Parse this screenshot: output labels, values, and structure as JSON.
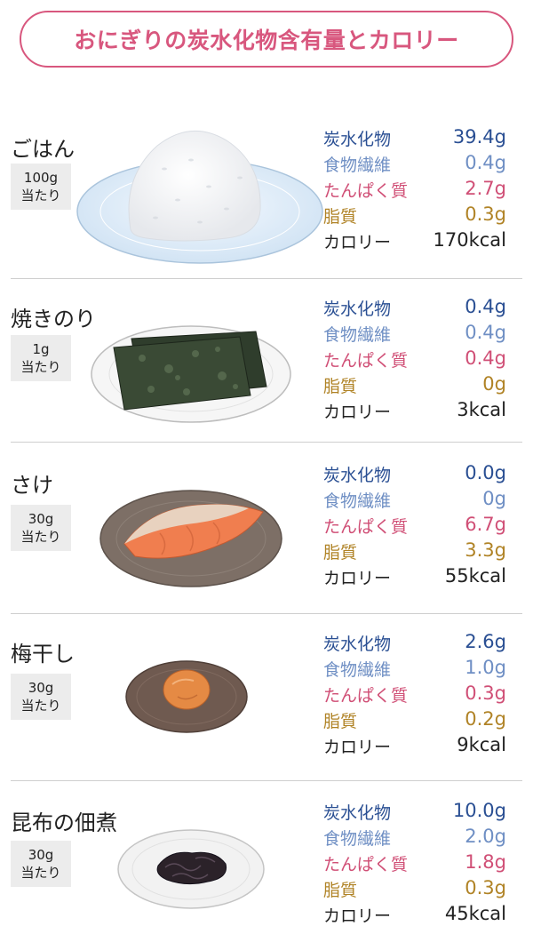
{
  "title": "おにぎりの炭水化物含有量とカロリー",
  "labels": {
    "carb": "炭水化物",
    "fiber": "食物繊維",
    "protein": "たんぱく質",
    "fat": "脂質",
    "calorie": "カロリー"
  },
  "colors": {
    "title": "#d8577e",
    "carb": "#2a4f93",
    "fiber": "#6f8fc4",
    "protein": "#d04f76",
    "fat": "#b08326",
    "calorie": "#222222"
  },
  "foods": [
    {
      "name": "ごはん",
      "amount": "100g",
      "per": "当たり",
      "carb": "39.4g",
      "fiber": "0.4g",
      "protein": "2.7g",
      "fat": "0.3g",
      "calorie": "170kcal",
      "icon": "onigiri-rice-icon"
    },
    {
      "name": "焼きのり",
      "amount": "1g",
      "per": "当たり",
      "carb": "0.4g",
      "fiber": "0.4g",
      "protein": "0.4g",
      "fat": "0g",
      "calorie": "3kcal",
      "icon": "nori-seaweed-icon"
    },
    {
      "name": "さけ",
      "amount": "30g",
      "per": "当たり",
      "carb": "0.0g",
      "fiber": "0g",
      "protein": "6.7g",
      "fat": "3.3g",
      "calorie": "55kcal",
      "icon": "salmon-icon"
    },
    {
      "name": "梅干し",
      "amount": "30g",
      "per": "当たり",
      "carb": "2.6g",
      "fiber": "1.0g",
      "protein": "0.3g",
      "fat": "0.2g",
      "calorie": "9kcal",
      "icon": "umeboshi-icon"
    },
    {
      "name": "昆布の佃煮",
      "amount": "30g",
      "per": "当たり",
      "carb": "10.0g",
      "fiber": "2.0g",
      "protein": "1.8g",
      "fat": "0.3g",
      "calorie": "45kcal",
      "icon": "kombu-tsukudani-icon"
    }
  ]
}
